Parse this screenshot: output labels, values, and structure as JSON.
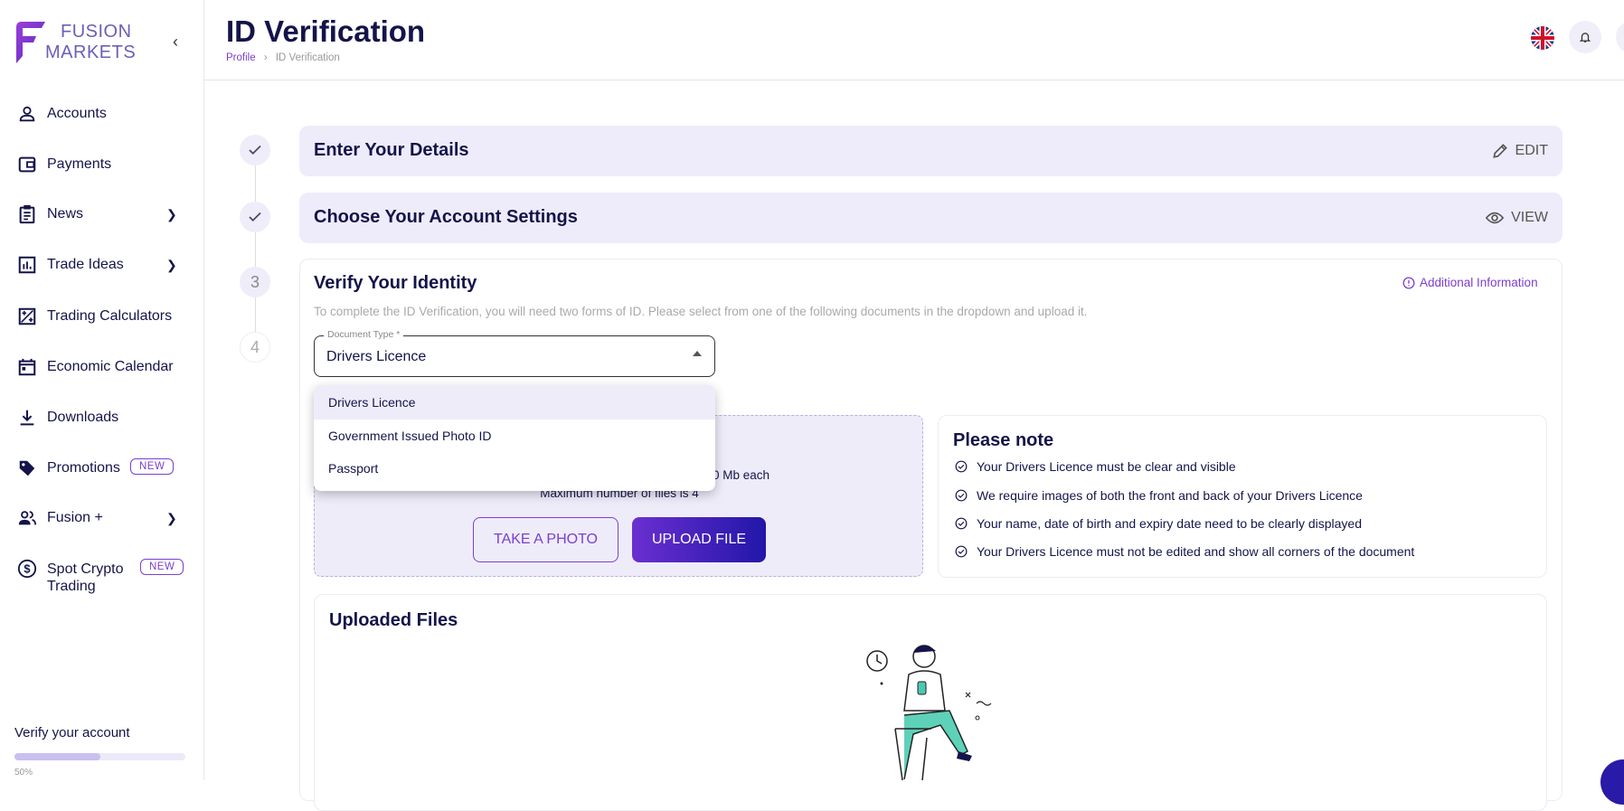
{
  "brand": {
    "line1": "FUSION",
    "line2": "MARKETS"
  },
  "sidebar": {
    "items": [
      {
        "label": "Accounts",
        "icon": "user-icon"
      },
      {
        "label": "Payments",
        "icon": "wallet-icon"
      },
      {
        "label": "News",
        "icon": "clipboard-icon",
        "expandable": true
      },
      {
        "label": "Trade Ideas",
        "icon": "bar-chart-icon",
        "expandable": true
      },
      {
        "label": "Trading Calculators",
        "icon": "calculator-icon"
      },
      {
        "label": "Economic Calendar",
        "icon": "calendar-icon"
      },
      {
        "label": "Downloads",
        "icon": "download-icon"
      },
      {
        "label": "Promotions",
        "icon": "tag-icon",
        "badge": "NEW"
      },
      {
        "label": "Fusion +",
        "icon": "group-icon",
        "expandable": true
      },
      {
        "label": "Spot Crypto",
        "label2": "Trading",
        "icon": "dollar-circle-icon",
        "badge": "NEW"
      }
    ],
    "verify": {
      "label": "Verify your account",
      "progress_percent": 50,
      "progress_text": "50%"
    }
  },
  "header": {
    "title": "ID Verification",
    "breadcrumb": [
      "Profile",
      "ID Verification"
    ]
  },
  "steps": [
    {
      "marker": "check",
      "title": "Enter Your Details",
      "action": "EDIT"
    },
    {
      "marker": "check",
      "title": "Choose Your Account Settings",
      "action": "VIEW"
    },
    {
      "marker": "3",
      "title": "Verify Your Identity"
    },
    {
      "marker": "4"
    }
  ],
  "verify": {
    "additional_info": "Additional Information",
    "description": "To complete the ID Verification, you will need two forms of ID. Please select from one of the following documents in the dropdown and upload it.",
    "document_type_label": "Document Type *",
    "document_type_value": "Drivers Licence",
    "options": [
      "Drivers Licence",
      "Government Issued Photo ID",
      "Passport"
    ],
    "upload_text1": "0 Mb each",
    "upload_text2": "Maximum number of files is 4",
    "take_photo": "TAKE A PHOTO",
    "upload_file": "UPLOAD FILE",
    "note_title": "Please note",
    "notes": [
      "Your Drivers Licence must be clear and visible",
      "We require images of both the front and back of your Drivers Licence",
      "Your name, date of birth and expiry date need to be clearly displayed",
      "Your Drivers Licence must not be edited and show all corners of the document"
    ],
    "uploaded_title": "Uploaded Files"
  },
  "colors": {
    "accent": "#7a3fd0",
    "navy": "#14144a",
    "card_bg": "#eeecfa"
  }
}
